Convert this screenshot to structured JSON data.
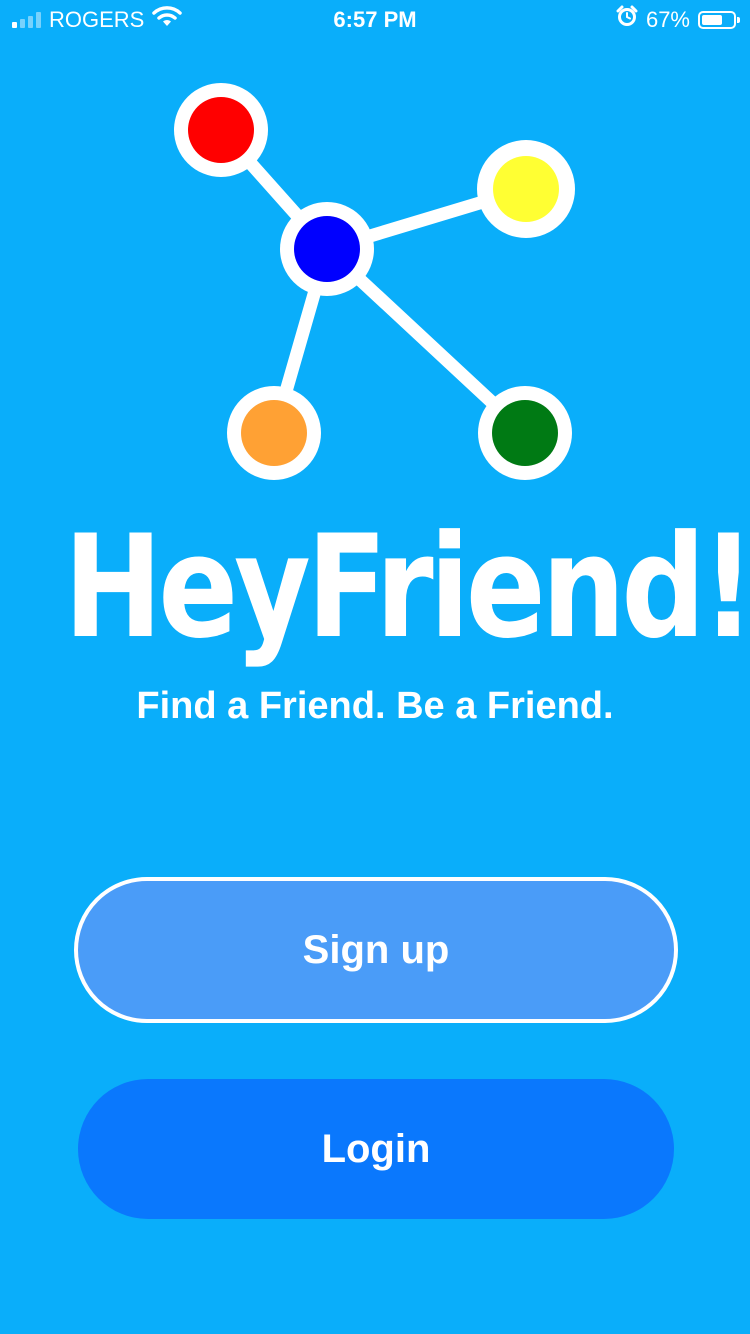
{
  "status_bar": {
    "carrier": "ROGERS",
    "time": "6:57 PM",
    "battery_percent": "67%",
    "battery_level": 0.67,
    "icons": [
      "signal-icon",
      "wifi-icon",
      "alarm-icon",
      "battery-icon"
    ]
  },
  "app": {
    "name": "HeyFriend!",
    "tagline": "Find a Friend. Be a Friend."
  },
  "logo": {
    "node_colors": {
      "red": "#ff0000",
      "yellow": "#ffff33",
      "blue": "#0000ff",
      "orange": "#ffa134",
      "green": "#007a14"
    },
    "outline_color": "#ffffff"
  },
  "actions": {
    "signup_label": "Sign up",
    "login_label": "Login"
  },
  "colors": {
    "background": "#0aaefa",
    "signup_button": "#4a9cf8",
    "login_button": "#0a78fd"
  }
}
